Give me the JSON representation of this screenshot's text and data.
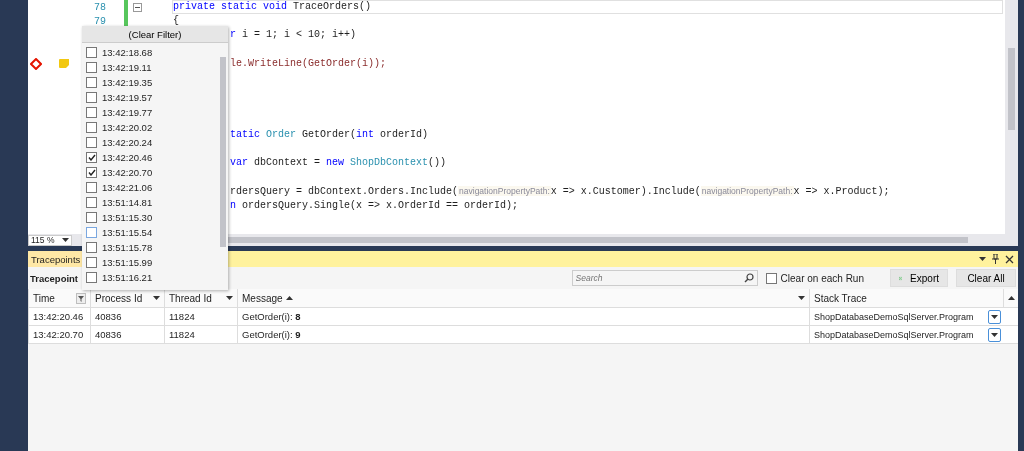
{
  "editor": {
    "lines": [
      {
        "number": "78",
        "highlighted": true,
        "collapsible": true,
        "covered": false,
        "breakpoint": false,
        "blank_before": false,
        "new_block": false,
        "segments": [
          {
            "kind": "keyword",
            "text": "private static void"
          },
          {
            "kind": "plain",
            "text": " TraceOrders()"
          }
        ]
      },
      {
        "number": "79",
        "highlighted": false,
        "collapsible": false,
        "covered": false,
        "breakpoint": false,
        "blank_before": false,
        "new_block": false,
        "segments": [
          {
            "kind": "plain",
            "text": "{"
          }
        ]
      },
      {
        "highlighted": false,
        "collapsible": false,
        "covered": true,
        "breakpoint": false,
        "blank_before": false,
        "new_block": false,
        "segments": [
          {
            "kind": "keyword",
            "text": "r"
          },
          {
            "kind": "plain",
            "text": " i = 1; i < 10; i++)"
          }
        ]
      },
      {
        "highlighted": false,
        "collapsible": false,
        "covered": true,
        "breakpoint": true,
        "blank_before": true,
        "new_block": false,
        "segments": [
          {
            "kind": "plain",
            "text": "le.WriteLine(GetOrder(i));"
          }
        ]
      },
      {
        "highlighted": false,
        "collapsible": false,
        "covered": true,
        "breakpoint": false,
        "blank_before": false,
        "new_block": true,
        "segments": [
          {
            "kind": "keyword",
            "text": "tatic"
          },
          {
            "kind": "type",
            "text": " Order"
          },
          {
            "kind": "plain",
            "text": " GetOrder("
          },
          {
            "kind": "keyword",
            "text": "int"
          },
          {
            "kind": "plain",
            "text": " orderId)"
          }
        ]
      },
      {
        "highlighted": false,
        "collapsible": false,
        "covered": true,
        "breakpoint": false,
        "blank_before": true,
        "new_block": false,
        "segments": [
          {
            "kind": "keyword",
            "text": "var"
          },
          {
            "kind": "plain",
            "text": " dbContext = "
          },
          {
            "kind": "keyword",
            "text": "new"
          },
          {
            "kind": "type",
            "text": " ShopDbContext"
          },
          {
            "kind": "plain",
            "text": "())"
          }
        ]
      },
      {
        "highlighted": false,
        "collapsible": false,
        "covered": true,
        "breakpoint": false,
        "blank_before": true,
        "new_block": false,
        "segments": [
          {
            "kind": "plain",
            "text": "rdersQuery = dbContext.Orders.Include("
          },
          {
            "kind": "hint",
            "text": "navigationPropertyPath:"
          },
          {
            "kind": "plain",
            "text": "x => x.Customer).Include("
          },
          {
            "kind": "hint",
            "text": "navigationPropertyPath:"
          },
          {
            "kind": "plain",
            "text": "x => x.Product);"
          }
        ]
      },
      {
        "highlighted": false,
        "collapsible": false,
        "covered": true,
        "breakpoint": false,
        "blank_before": false,
        "new_block": false,
        "segments": [
          {
            "kind": "keyword",
            "text": "n"
          },
          {
            "kind": "plain",
            "text": " ordersQuery.Single(x => x.OrderId == orderId);"
          }
        ]
      }
    ],
    "zoom": "115 %"
  },
  "filter_popup": {
    "clear_label": "(Clear Filter)",
    "items": [
      {
        "label": "13:42:18.68",
        "checked": false,
        "focused": false
      },
      {
        "label": "13:42:19.11",
        "checked": false,
        "focused": false
      },
      {
        "label": "13:42:19.35",
        "checked": false,
        "focused": false
      },
      {
        "label": "13:42:19.57",
        "checked": false,
        "focused": false
      },
      {
        "label": "13:42:19.77",
        "checked": false,
        "focused": false
      },
      {
        "label": "13:42:20.02",
        "checked": false,
        "focused": false
      },
      {
        "label": "13:42:20.24",
        "checked": false,
        "focused": false
      },
      {
        "label": "13:42:20.46",
        "checked": true,
        "focused": false
      },
      {
        "label": "13:42:20.70",
        "checked": true,
        "focused": false
      },
      {
        "label": "13:42:21.06",
        "checked": false,
        "focused": false
      },
      {
        "label": "13:51:14.81",
        "checked": false,
        "focused": false
      },
      {
        "label": "13:51:15.30",
        "checked": false,
        "focused": false
      },
      {
        "label": "13:51:15.54",
        "checked": false,
        "focused": true
      },
      {
        "label": "13:51:15.78",
        "checked": false,
        "focused": false
      },
      {
        "label": "13:51:15.99",
        "checked": false,
        "focused": false
      },
      {
        "label": "13:51:16.21",
        "checked": false,
        "focused": false
      }
    ]
  },
  "tool_window": {
    "tab": "Tracepoints",
    "title": "Tracepoint",
    "search": {
      "placeholder": "Search"
    },
    "clear_on_run": {
      "label": "Clear on each Run",
      "checked": false
    },
    "buttons": [
      {
        "kind": "export",
        "label": "Export"
      },
      {
        "kind": "plain",
        "label": "Clear All"
      }
    ]
  },
  "table": {
    "columns": [
      {
        "label": "Time",
        "filtered": true,
        "filterable": true,
        "sorted_ascending": false
      },
      {
        "label": "Process Id",
        "filtered": false,
        "filterable": true,
        "sorted_ascending": false
      },
      {
        "label": "Thread Id",
        "filtered": false,
        "filterable": true,
        "sorted_ascending": false
      },
      {
        "label": "Message",
        "filtered": false,
        "filterable": true,
        "sorted_ascending": true
      },
      {
        "label": "Stack Trace",
        "filtered": false,
        "filterable": false,
        "sorted_ascending": false
      }
    ],
    "rows": [
      [
        "13:42:20.46",
        "40836",
        "11824",
        "GetOrder(i): **8**",
        "ShopDatabaseDemoSqlServer.Program"
      ],
      [
        "13:42:20.70",
        "40836",
        "11824",
        "GetOrder(i): **9**",
        "ShopDatabaseDemoSqlServer.Program"
      ]
    ]
  }
}
